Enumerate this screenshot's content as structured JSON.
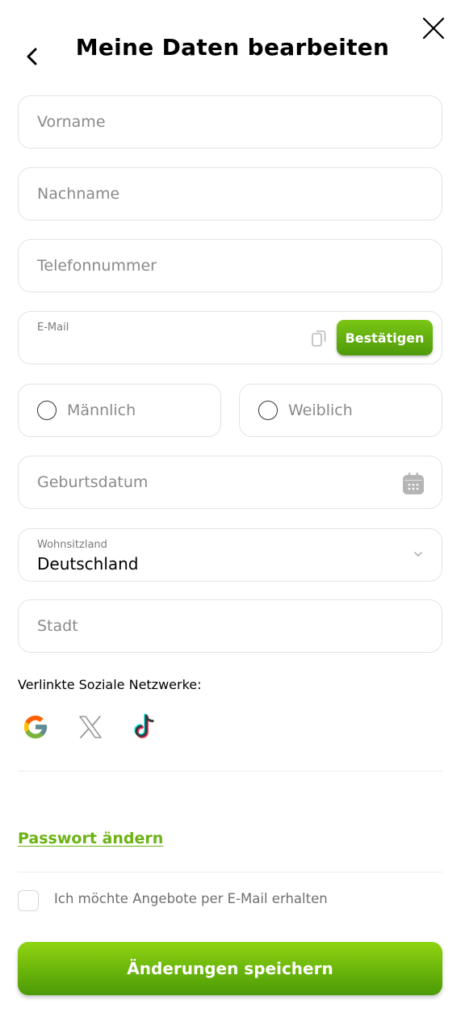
{
  "header": {
    "title": "Meine Daten bearbeiten"
  },
  "form": {
    "first_name_placeholder": "Vorname",
    "last_name_placeholder": "Nachname",
    "phone_placeholder": "Telefonnummer",
    "email_label": "E-Mail",
    "email_value": "",
    "confirm_label": "Bestätigen",
    "gender_male": "Männlich",
    "gender_female": "Weiblich",
    "birthdate_placeholder": "Geburtsdatum",
    "country_label": "Wohnsitzland",
    "country_value": "Deutschland",
    "city_placeholder": "Stadt"
  },
  "social": {
    "label": "Verlinkte Soziale Netzwerke:",
    "icons": [
      "google-icon",
      "x-icon",
      "tiktok-icon"
    ]
  },
  "links": {
    "change_password": "Passwort ändern"
  },
  "newsletter": {
    "label": "Ich möchte Angebote per E-Mail erhalten",
    "checked": false
  },
  "actions": {
    "save_label": "Änderungen speichern"
  },
  "colors": {
    "accent": "#6cb214",
    "button_top": "#8fd411",
    "button_bottom": "#4b9a06"
  }
}
